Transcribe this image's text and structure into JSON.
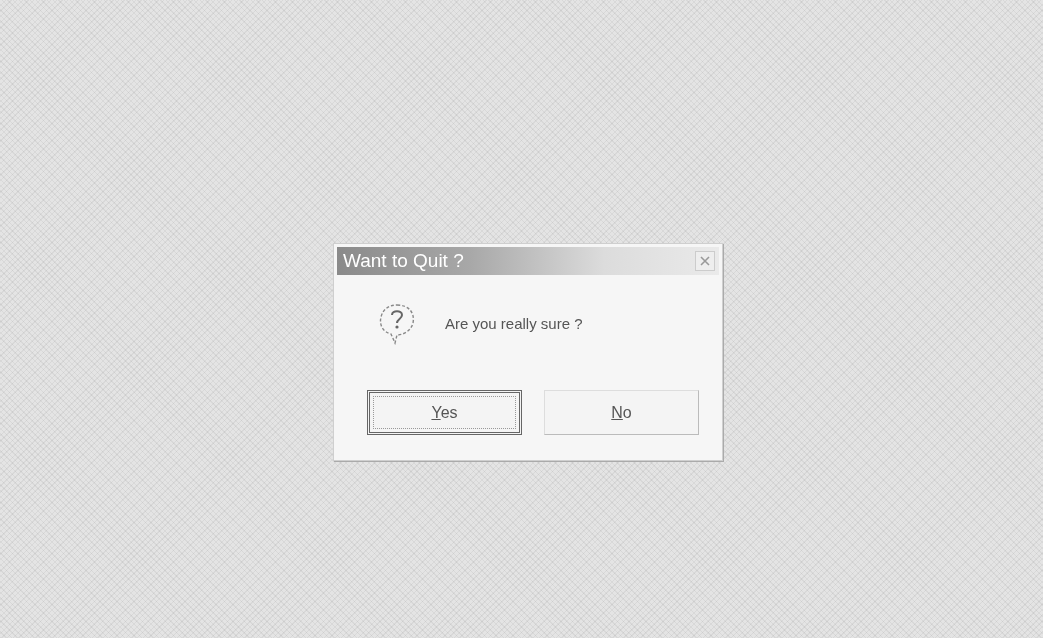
{
  "dialog": {
    "title": "Want to Quit ?",
    "message": "Are you really sure ?",
    "buttons": [
      {
        "label": "Yes",
        "mnemonic_underlined": true,
        "default": true
      },
      {
        "label": "No",
        "mnemonic_underlined": true,
        "default": false
      }
    ]
  }
}
